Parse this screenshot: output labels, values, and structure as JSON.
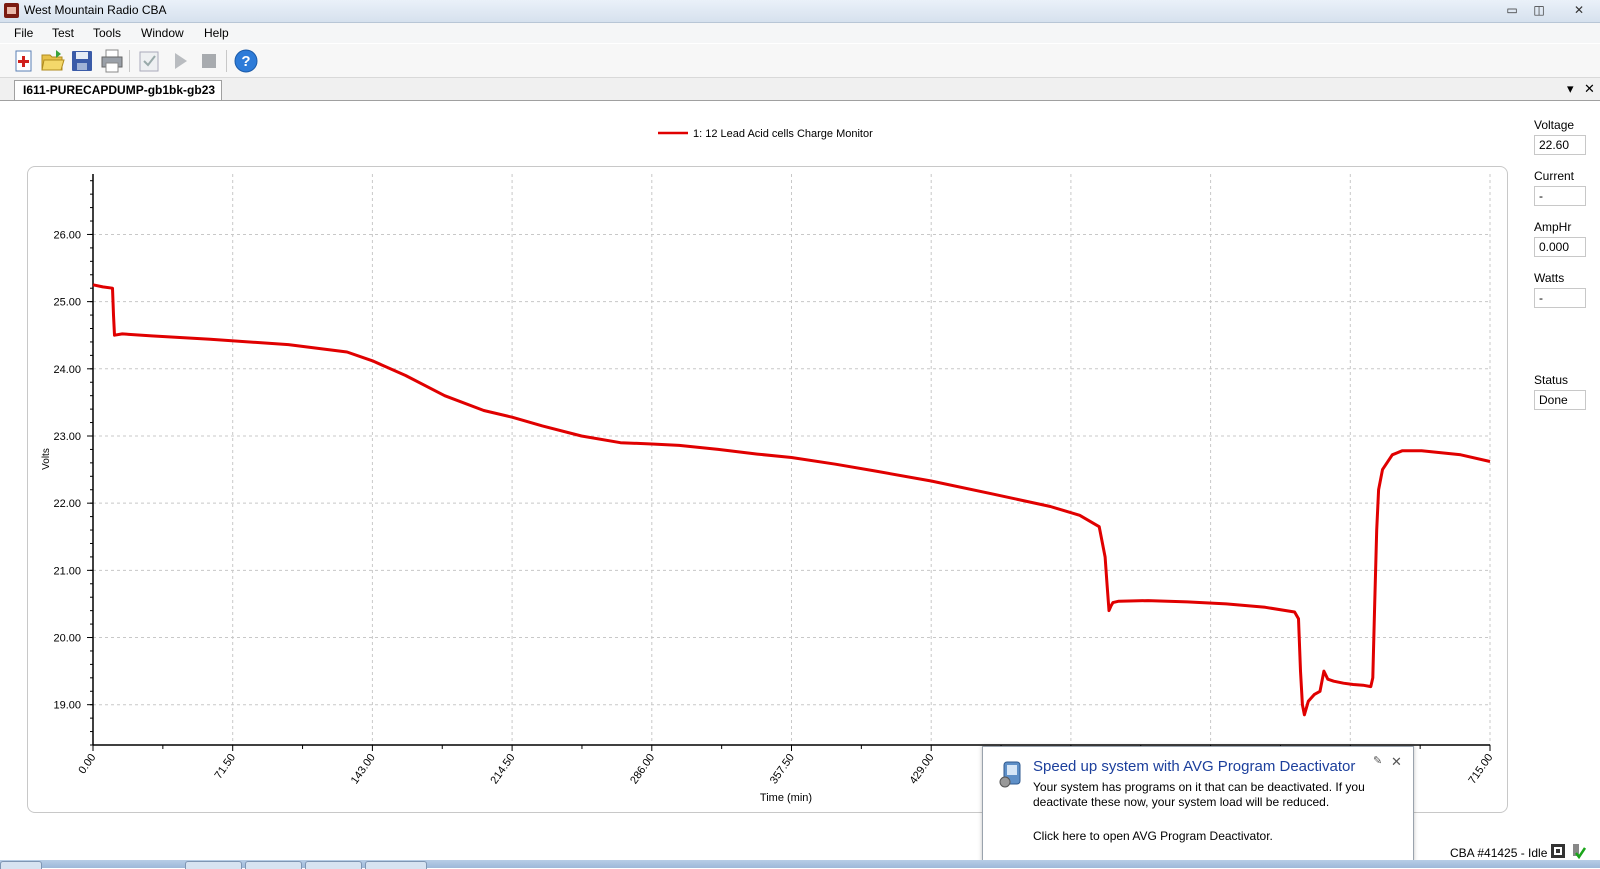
{
  "window": {
    "title": "West Mountain Radio CBA",
    "controls": {
      "minimize": "▭",
      "restore": "◫",
      "close": "✕"
    }
  },
  "menu": [
    "File",
    "Test",
    "Tools",
    "Window",
    "Help"
  ],
  "toolbar": {
    "icons": [
      "new-test-icon",
      "open-folder-icon",
      "save-icon",
      "print-icon",
      "checklist-icon",
      "play-icon",
      "stop-icon",
      "help-icon"
    ]
  },
  "tab": {
    "label": "I611-PURECAPDUMP-gb1bk-gb23",
    "menu_glyph": "▾",
    "close_glyph": "✕"
  },
  "side_panel": {
    "voltage_label": "Voltage",
    "voltage_value": "22.60",
    "current_label": "Current",
    "current_value": "-",
    "amphr_label": "AmpHr",
    "amphr_value": "0.000",
    "watts_label": "Watts",
    "watts_value": "-",
    "status_label": "Status",
    "status_value": "Done"
  },
  "notification": {
    "title": "Speed up system with AVG Program Deactivator",
    "body": "Your system has programs on it that can be deactivated. If you deactivate these now, your system load will be reduced.",
    "link": "Click here to open AVG Program Deactivator.",
    "close_glyph": "✕",
    "pin_glyph": "✎"
  },
  "statusbar": {
    "text": "CBA #41425 - Idle"
  },
  "colors": {
    "series": "#e00000",
    "grid": "#c8c8c8"
  },
  "chart_data": {
    "type": "line",
    "legend": "1: 12 Lead Acid cells Charge Monitor",
    "legend_position": "top-center",
    "xlabel": "Time (min)",
    "ylabel": "Volts",
    "xlim": [
      0,
      715
    ],
    "ylim": [
      18.4,
      26.9
    ],
    "xticks": [
      0,
      71.5,
      143,
      214.5,
      286,
      357.5,
      429,
      500.5,
      572,
      643.5,
      715
    ],
    "xtick_labels": [
      "0.00",
      "71.50",
      "143.00",
      "214.50",
      "286.00",
      "357.50",
      "429.00",
      "",
      "",
      "",
      "715.00"
    ],
    "yticks": [
      19,
      20,
      21,
      22,
      23,
      24,
      25,
      26
    ],
    "ytick_labels": [
      "19.00",
      "20.00",
      "21.00",
      "22.00",
      "23.00",
      "24.00",
      "25.00",
      "26.00"
    ],
    "grid": true,
    "series": [
      {
        "x": [
          0,
          5,
          10,
          10.5,
          11,
          15,
          30,
          60,
          100,
          130,
          143,
          160,
          180,
          200,
          214.5,
          230,
          250,
          270,
          286,
          300,
          320,
          340,
          357.5,
          380,
          400,
          429,
          460,
          490,
          505,
          515,
          518,
          519,
          520,
          521,
          522,
          525,
          540,
          560,
          580,
          600,
          615,
          617,
          618,
          619,
          620,
          622,
          625,
          628,
          630,
          632,
          635,
          640,
          645,
          650,
          654,
          655,
          656,
          657,
          658,
          660,
          665,
          670,
          680,
          690,
          700,
          715
        ],
        "y": [
          25.25,
          25.22,
          25.2,
          24.8,
          24.5,
          24.52,
          24.49,
          24.44,
          24.36,
          24.25,
          24.12,
          23.9,
          23.6,
          23.38,
          23.28,
          23.15,
          23.0,
          22.9,
          22.88,
          22.86,
          22.8,
          22.73,
          22.68,
          22.58,
          22.48,
          22.33,
          22.14,
          21.95,
          21.82,
          21.65,
          21.2,
          20.8,
          20.4,
          20.47,
          20.52,
          20.54,
          20.55,
          20.53,
          20.5,
          20.45,
          20.38,
          20.28,
          19.5,
          19.0,
          18.85,
          19.05,
          19.15,
          19.2,
          19.5,
          19.38,
          19.35,
          19.32,
          19.3,
          19.29,
          19.27,
          19.4,
          20.5,
          21.6,
          22.2,
          22.5,
          22.72,
          22.78,
          22.78,
          22.75,
          22.72,
          22.62
        ]
      }
    ]
  }
}
